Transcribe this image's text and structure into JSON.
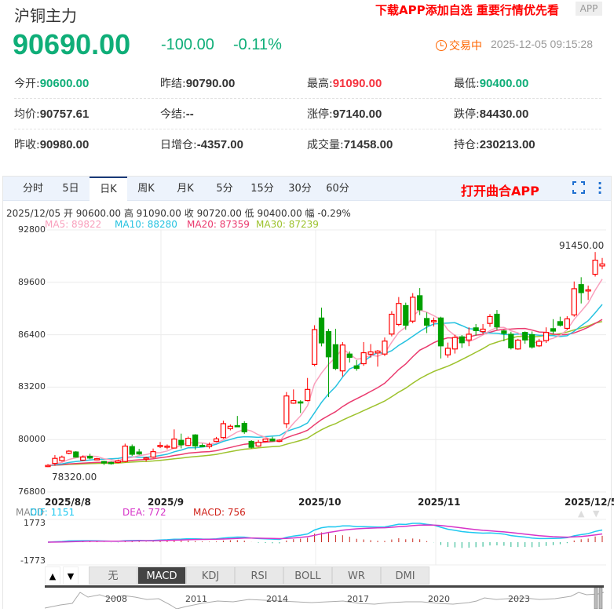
{
  "header": {
    "title": "沪铜主力",
    "promo": "下载APP添加自选 重要行情优先看",
    "app_badge": "APP"
  },
  "quote": {
    "price": "90690.00",
    "change": "-100.00",
    "change_pct": "-0.11%",
    "status": "交易中",
    "timestamp": "2025-12-05 09:15:28",
    "color_down": "#0fae78",
    "color_up": "#f5333f",
    "status_color": "#ff6600"
  },
  "stats": [
    {
      "label": "今开:",
      "value": "90600.00",
      "color": "#0fae78"
    },
    {
      "label": "昨结:",
      "value": "90790.00",
      "color": "#333333"
    },
    {
      "label": "最高:",
      "value": "91090.00",
      "color": "#f5333f"
    },
    {
      "label": "最低:",
      "value": "90400.00",
      "color": "#0fae78"
    },
    {
      "label": "均价:",
      "value": "90757.61",
      "color": "#333333"
    },
    {
      "label": "今结:",
      "value": "--",
      "color": "#333333"
    },
    {
      "label": "涨停:",
      "value": "97140.00",
      "color": "#333333"
    },
    {
      "label": "跌停:",
      "value": "84430.00",
      "color": "#333333"
    },
    {
      "label": "昨收:",
      "value": "90980.00",
      "color": "#333333"
    },
    {
      "label": "日增仓:",
      "value": "-4357.00",
      "color": "#333333"
    },
    {
      "label": "成交量:",
      "value": "71458.00",
      "color": "#333333"
    },
    {
      "label": "持仓:",
      "value": "230213.00",
      "color": "#333333"
    }
  ],
  "tabs": [
    "分时",
    "5日",
    "日K",
    "周K",
    "月K",
    "5分",
    "15分",
    "30分",
    "60分"
  ],
  "active_tab": "日K",
  "open_app": "打开曲合APP",
  "info_line": "2025/12/05  开 90600.00  高 91090.00  收 90720.00  低 90400.00  幅 -0.29%",
  "ma_legend": [
    {
      "text": "MA5: 89822",
      "color": "#f9a0bd"
    },
    {
      "text": "MA10: 88280",
      "color": "#25c2e0"
    },
    {
      "text": "MA20: 87359",
      "color": "#ea3a6e"
    },
    {
      "text": "MA30: 87239",
      "color": "#9dc22c"
    }
  ],
  "chart_data": {
    "type": "candlestick",
    "ylim": [
      76800,
      92800
    ],
    "yticks": [
      "92800",
      "89600",
      "86400",
      "83200",
      "80000",
      "76800"
    ],
    "xticks": [
      "2025/8/8",
      "2025/9",
      "2025/10",
      "2025/11",
      "2025/12/5"
    ],
    "max_label": "91450.00",
    "min_label": "78320.00",
    "up_color": "#ff0000",
    "down_color": "#00a000",
    "ohlc": [
      [
        78350,
        78500,
        78320,
        78420
      ],
      [
        78540,
        79050,
        78400,
        78850
      ],
      [
        78710,
        79020,
        78650,
        78930
      ],
      [
        79160,
        79350,
        79100,
        79290
      ],
      [
        79240,
        79290,
        78900,
        78930
      ],
      [
        78740,
        79030,
        78700,
        78930
      ],
      [
        78970,
        79130,
        78800,
        78870
      ],
      [
        78820,
        78880,
        78760,
        78830
      ],
      [
        78660,
        78700,
        78450,
        78570
      ],
      [
        78600,
        78660,
        78470,
        78590
      ],
      [
        78600,
        78780,
        78560,
        78690
      ],
      [
        78660,
        79750,
        78600,
        79600
      ],
      [
        79570,
        79700,
        79000,
        79100
      ],
      [
        79240,
        79430,
        79060,
        79120
      ],
      [
        78820,
        78950,
        78660,
        78880
      ],
      [
        78930,
        79450,
        78880,
        79260
      ],
      [
        79600,
        79850,
        79480,
        79640
      ],
      [
        79580,
        79700,
        79400,
        79600
      ],
      [
        79480,
        80620,
        79460,
        80030
      ],
      [
        79950,
        80360,
        79460,
        79680
      ],
      [
        79640,
        80180,
        79600,
        80075
      ],
      [
        80280,
        80330,
        79380,
        79610
      ],
      [
        79640,
        79760,
        79550,
        79570
      ],
      [
        79570,
        79820,
        79450,
        79680
      ],
      [
        79890,
        80160,
        79850,
        80040
      ],
      [
        80120,
        81150,
        80050,
        80970
      ],
      [
        80670,
        80920,
        80560,
        80810
      ],
      [
        80850,
        81440,
        80760,
        80830
      ],
      [
        80985,
        81120,
        80350,
        80470
      ],
      [
        79890,
        79960,
        79450,
        79525
      ],
      [
        79605,
        79970,
        79560,
        79830
      ],
      [
        79890,
        80060,
        79850,
        80030
      ],
      [
        80030,
        80170,
        79880,
        79920
      ],
      [
        79930,
        80020,
        79860,
        79960
      ],
      [
        80970,
        82900,
        80700,
        82660
      ],
      [
        82220,
        83060,
        82180,
        82380
      ],
      [
        82300,
        82400,
        81620,
        82270
      ],
      [
        82380,
        83760,
        82330,
        83060
      ],
      [
        84590,
        86980,
        84480,
        86710
      ],
      [
        87420,
        88050,
        85690,
        85900
      ],
      [
        86590,
        86760,
        82590,
        85050
      ],
      [
        85790,
        86760,
        84240,
        84340
      ],
      [
        84190,
        85950,
        83850,
        85770
      ],
      [
        85220,
        85380,
        84700,
        85020
      ],
      [
        84500,
        84850,
        84200,
        84340
      ],
      [
        84630,
        85950,
        84500,
        85300
      ],
      [
        85210,
        85830,
        85000,
        85350
      ],
      [
        85290,
        85470,
        84450,
        85400
      ],
      [
        85220,
        86230,
        85100,
        86010
      ],
      [
        86440,
        87840,
        86300,
        87650
      ],
      [
        87030,
        88700,
        86930,
        88310
      ],
      [
        88180,
        88360,
        86700,
        86980
      ],
      [
        87230,
        88940,
        87100,
        88690
      ],
      [
        88780,
        89250,
        87600,
        87920
      ],
      [
        87390,
        87760,
        86500,
        86980
      ],
      [
        87230,
        87450,
        86900,
        87260
      ],
      [
        87420,
        87500,
        84950,
        85720
      ],
      [
        85170,
        85920,
        85000,
        85570
      ],
      [
        85530,
        86400,
        85250,
        86230
      ],
      [
        86270,
        86380,
        85600,
        85910
      ],
      [
        86080,
        86850,
        85700,
        86430
      ],
      [
        86820,
        87050,
        86350,
        86650
      ],
      [
        86590,
        87050,
        86400,
        86740
      ],
      [
        87090,
        87660,
        86880,
        87510
      ],
      [
        87650,
        87910,
        86700,
        86880
      ],
      [
        86630,
        86700,
        86000,
        86480
      ],
      [
        86430,
        86580,
        85500,
        85600
      ],
      [
        85530,
        86150,
        85480,
        86070
      ],
      [
        86540,
        86600,
        85850,
        86080
      ],
      [
        86400,
        86600,
        85550,
        85650
      ],
      [
        85720,
        86150,
        85650,
        86000
      ],
      [
        86040,
        86850,
        85900,
        86540
      ],
      [
        86770,
        87350,
        86450,
        86620
      ],
      [
        87200,
        87500,
        86900,
        86980
      ],
      [
        86790,
        87530,
        86700,
        87370
      ],
      [
        87610,
        89650,
        87500,
        89210
      ],
      [
        89460,
        89910,
        88310,
        88970
      ],
      [
        89080,
        89400,
        88520,
        89140
      ],
      [
        90090,
        91450,
        89950,
        90950
      ],
      [
        90600,
        91090,
        90400,
        90720
      ]
    ],
    "macd": {
      "ylim": [
        -1773,
        1773
      ],
      "yticks": [
        "1773",
        "-1773"
      ],
      "legend": [
        {
          "text": "MACD",
          "color": "#888888"
        },
        {
          "text": "DIF: 1151",
          "color": "#1ec8f0"
        },
        {
          "text": "DEA: 772",
          "color": "#d633c8"
        },
        {
          "text": "MACD: 756",
          "color": "#d0241c"
        }
      ]
    }
  },
  "indicators": {
    "up": "▲",
    "down": "▼",
    "items": [
      "无",
      "MACD",
      "KDJ",
      "RSI",
      "BOLL",
      "WR",
      "DMI"
    ],
    "active": "MACD"
  },
  "navigator": {
    "years": [
      "2008",
      "2011",
      "2014",
      "2017",
      "2020",
      "2023"
    ]
  }
}
